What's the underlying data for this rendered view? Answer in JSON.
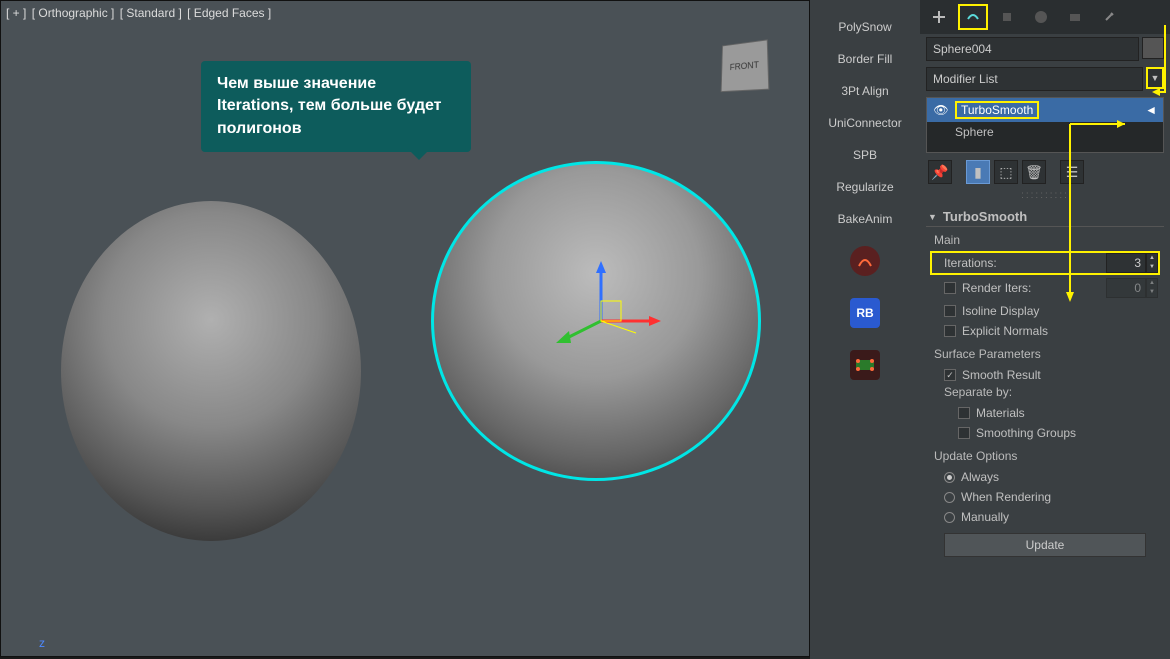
{
  "viewport": {
    "labels": [
      "[ + ]",
      "[ Orthographic ]",
      "[ Standard ]",
      "[ Edged Faces ]"
    ],
    "callout": "Чем выше значение Iterations, тем больше будет полигонов",
    "z_axis": "z",
    "viewcube": "FRONT"
  },
  "tools_strip": [
    "PolySnow",
    "Border Fill",
    "3Pt Align",
    "UniConnector",
    "SPB",
    "Regularize",
    "BakeAnim"
  ],
  "tool_icons": {
    "rb_label": "RB"
  },
  "panel": {
    "object_name": "Sphere004",
    "modifier_list_label": "Modifier List",
    "stack": {
      "selected": "TurboSmooth",
      "base": "Sphere"
    },
    "rollout_title": "TurboSmooth",
    "main": {
      "label": "Main",
      "iterations_label": "Iterations:",
      "iterations_value": "3",
      "render_iters_label": "Render Iters:",
      "render_iters_value": "0",
      "isoline": "Isoline Display",
      "explicit": "Explicit Normals"
    },
    "surface": {
      "label": "Surface Parameters",
      "smooth_result": "Smooth Result",
      "separate_by": "Separate by:",
      "materials": "Materials",
      "smoothing_groups": "Smoothing Groups"
    },
    "update": {
      "label": "Update Options",
      "always": "Always",
      "rendering": "When Rendering",
      "manually": "Manually",
      "button": "Update"
    }
  },
  "colors": {
    "highlight": "#fff200"
  }
}
